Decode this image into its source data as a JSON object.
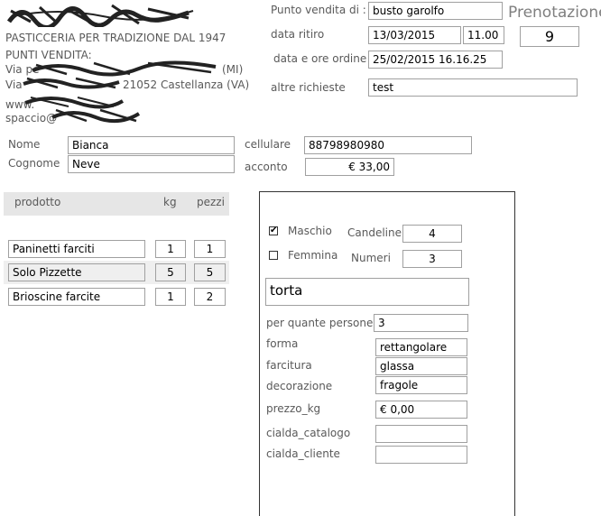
{
  "company": {
    "tagline": "PASTICCERIA PER TRADIZIONE DAL 1947",
    "stores_label": "PUNTI VENDITA:",
    "store1_suffix": "(MI)",
    "store2_suffix": "21052 Castellanza (VA)",
    "web_prefix": "www.",
    "mail_prefix": "spaccio@"
  },
  "order": {
    "store_label": "Punto vendita di :",
    "store_value": "busto garolfo",
    "title": "Prenotazione",
    "number": "9",
    "pickup_label": "data ritiro",
    "pickup_date": "13/03/2015",
    "pickup_time": "11.00",
    "ordered_label": "data e ore ordine",
    "ordered_value": "25/02/2015 16.16.25",
    "requests_label": "altre richieste",
    "requests_value": "test"
  },
  "customer": {
    "name_label": "Nome",
    "name_value": "Bianca",
    "surname_label": "Cognome",
    "surname_value": "Neve",
    "mobile_label": "cellulare",
    "mobile_value": "88798980980",
    "deposit_label": "acconto",
    "deposit_value": "€ 33,00"
  },
  "products": {
    "headers": {
      "product": "prodotto",
      "kg": "kg",
      "pieces": "pezzi"
    },
    "rows": [
      {
        "name": "Paninetti farciti",
        "kg": "1",
        "pieces": "1"
      },
      {
        "name": "Solo Pizzette",
        "kg": "5",
        "pieces": "5"
      },
      {
        "name": "Brioscine farcite",
        "kg": "1",
        "pieces": "2"
      }
    ]
  },
  "cake": {
    "male_label": "Maschio",
    "male_checked": true,
    "female_label": "Femmina",
    "female_checked": false,
    "candles_label": "Candeline",
    "candles_value": "4",
    "numbers_label": "Numeri",
    "numbers_value": "3",
    "type_value": "torta",
    "people_label": "per quante persone",
    "people_value": "3",
    "shape_label": "forma",
    "shape_value": "rettangolare",
    "filling_label": "farcitura",
    "filling_value": "glassa",
    "decoration_label": "decorazione",
    "decoration_value": "fragole",
    "price_label": "prezzo_kg",
    "price_value": "€ 0,00",
    "wafer_catalog_label": "cialda_catalogo",
    "wafer_catalog_value": "",
    "wafer_customer_label": "cialda_cliente",
    "wafer_customer_value": ""
  }
}
